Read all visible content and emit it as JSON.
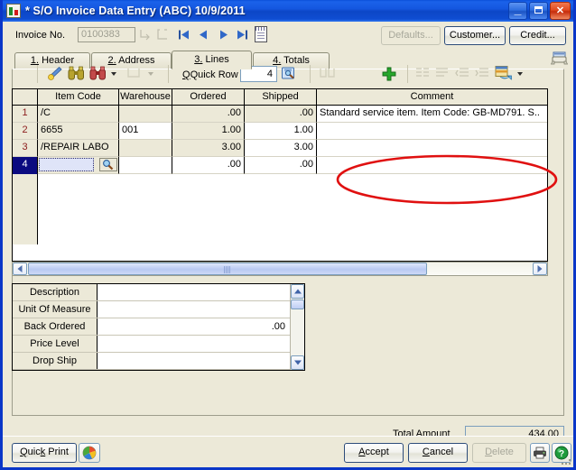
{
  "window": {
    "title": "* S/O Invoice Data Entry (ABC) 10/9/2011",
    "icon": "sage-app-icon",
    "minimize_label": "_",
    "maximize_label": "",
    "close_label": "✕",
    "accent_title_color": "#0c46c6",
    "border_color": "#0a36c8",
    "face_color": "#ece9d8"
  },
  "toolbar": {
    "invoice_label": "Invoice No.",
    "invoice_value": "0100383",
    "nav_first": "first-record",
    "nav_prev": "previous-record",
    "nav_next": "next-record",
    "nav_last": "last-record",
    "memo": "memo-icon",
    "defaults_label": "Defaults...",
    "customer_label": "Customer...",
    "credit_label": "Credit...",
    "batch_icon": "batch-icon"
  },
  "tabs": [
    {
      "num": "1.",
      "label": " Header",
      "active": false
    },
    {
      "num": "2.",
      "label": " Address",
      "active": false
    },
    {
      "num": "3.",
      "label": " Lines",
      "active": true
    },
    {
      "num": "4.",
      "label": " Totals",
      "active": false
    }
  ],
  "gridbar": {
    "quick_row_label": "Quick Row",
    "quick_row_value": "4",
    "icons": [
      "pencil-line-entry-icon",
      "binoculars-search-icon",
      "binoculars-search-next-icon",
      "dropdown-arrow-icon",
      "blank-row-icon",
      "dropdown-arrow-icon",
      "insert-row-icon",
      "delete-row-icon",
      "plus-add-row-icon",
      "indent-icon",
      "outdent-icon",
      "list-left-icon",
      "list-right-icon",
      "grid-settings-icon",
      "dropdown-arrow-icon"
    ]
  },
  "grid": {
    "columns": [
      "",
      "Item Code",
      "Warehouse",
      "Ordered",
      "Shipped",
      "Comment"
    ],
    "rows": [
      {
        "num": "1",
        "item_code": "/C",
        "warehouse": "",
        "ordered": ".00",
        "shipped": ".00",
        "comment": "Standard service item. Item Code: GB-MD791. S..",
        "shaded": true,
        "selected": false
      },
      {
        "num": "2",
        "item_code": "6655",
        "warehouse": "001",
        "ordered": "1.00",
        "shipped": "1.00",
        "comment": "",
        "shaded": false,
        "selected": false
      },
      {
        "num": "3",
        "item_code": "/REPAIR LABO",
        "warehouse": "",
        "ordered": "3.00",
        "shipped": "3.00",
        "comment": "",
        "shaded": true,
        "selected": false
      },
      {
        "num": "4",
        "item_code": "",
        "warehouse": "",
        "ordered": ".00",
        "shipped": ".00",
        "comment": "",
        "shaded": false,
        "selected": true
      }
    ],
    "lookup_icon": "magnifier-lookup-icon"
  },
  "detail": {
    "rows": [
      {
        "label": "Description",
        "value": ""
      },
      {
        "label": "Unit Of Measure",
        "value": ""
      },
      {
        "label": "Back Ordered",
        "value": ".00"
      },
      {
        "label": "Price Level",
        "value": ""
      },
      {
        "label": "Drop Ship",
        "value": ""
      }
    ]
  },
  "totals": {
    "label": "Total Amount",
    "value": "434.00"
  },
  "footer": {
    "quick_print_label": "Quick Print",
    "quick_print_icon": "sage-logo-icon",
    "accept_label": "Accept",
    "cancel_label": "Cancel",
    "delete_label": "Delete",
    "print_icon": "printer-icon",
    "help_icon": "help-question-icon"
  },
  "annotation": {
    "shape": "ellipse",
    "color": "#e01010",
    "target": "comment-column"
  }
}
